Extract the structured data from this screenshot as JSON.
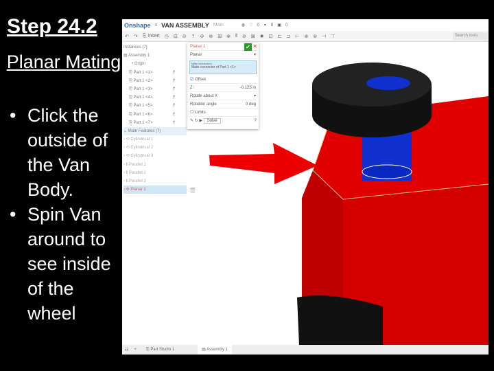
{
  "slide": {
    "title": "Step 24.2",
    "subtitle": "Planar Mating",
    "bullets": [
      "Click the outside of the Van Body.",
      "Spin Van around to see inside of the wheel"
    ]
  },
  "app": {
    "logo": "Onshape",
    "doc_title": "VAN ASSEMBLY",
    "workspace": "Main",
    "insert": "Insert",
    "search_placeholder": "Search tools",
    "counts": [
      "0",
      "0",
      "0"
    ]
  },
  "tree": {
    "instances_header": "Instances (7)",
    "assembly": "Assembly 1",
    "origin": "Origin",
    "parts": [
      "Part 1 <1>",
      "Part 1 <2>",
      "Part 1 <3>",
      "Part 1 <4>",
      "Part 1 <5>",
      "Part 1 <6>",
      "Part 1 <7>"
    ],
    "mates_header": "Mate Features (7)",
    "mates": [
      "Cylindrical 1",
      "Cylindrical 2",
      "Cylindrical 3",
      "Parallel 1",
      "Parallel 2",
      "Parallel 3",
      "Planar 1"
    ]
  },
  "dialog": {
    "title": "Planar 1",
    "type": "Planar",
    "mc_label": "Mate connectors",
    "mc_value": "Mate connector of Part 1 <1>",
    "offset": "Offset",
    "z_label": "Z",
    "z_value": "-0.125 in",
    "rotate": "Rotate about X",
    "rotation_label": "Rotation angle",
    "rotation_value": "0 deg",
    "limits": "Limits",
    "solve": "Solve"
  },
  "tabs": {
    "part_studio": "Part Studio 1",
    "assembly": "Assembly 1"
  },
  "colors": {
    "body": "#e00000",
    "wheel": "#111111",
    "axle": "#1030d0",
    "arrow": "#ee0000"
  }
}
